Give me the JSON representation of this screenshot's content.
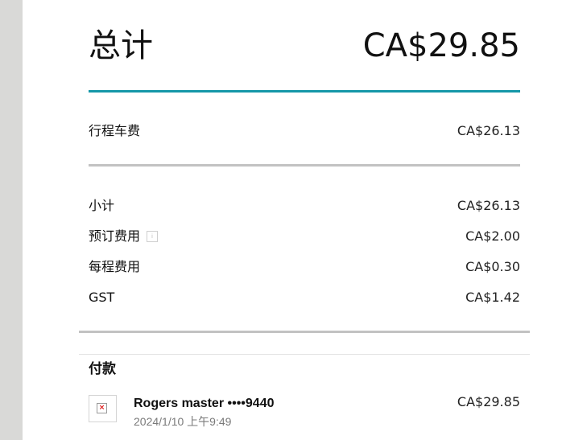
{
  "total": {
    "label": "总计",
    "amount": "CA$29.85"
  },
  "fare": {
    "label": "行程车费",
    "amount": "CA$26.13"
  },
  "breakdown": [
    {
      "label": "小计",
      "amount": "CA$26.13"
    },
    {
      "label": "预订费用",
      "amount": "CA$2.00",
      "info_icon": "info-icon"
    },
    {
      "label": "每程费用",
      "amount": "CA$0.30"
    },
    {
      "label": "GST",
      "amount": "CA$1.42"
    }
  ],
  "payment": {
    "title": "付款",
    "method_name": "Rogers master ••••9440",
    "datetime": "2024/1/10 上午9:49",
    "amount": "CA$29.85",
    "card_icon": "broken-image-icon"
  },
  "colors": {
    "accent_rule": "#1597a8",
    "divider": "#c2c2c2",
    "left_bar": "#d9d9d7"
  }
}
